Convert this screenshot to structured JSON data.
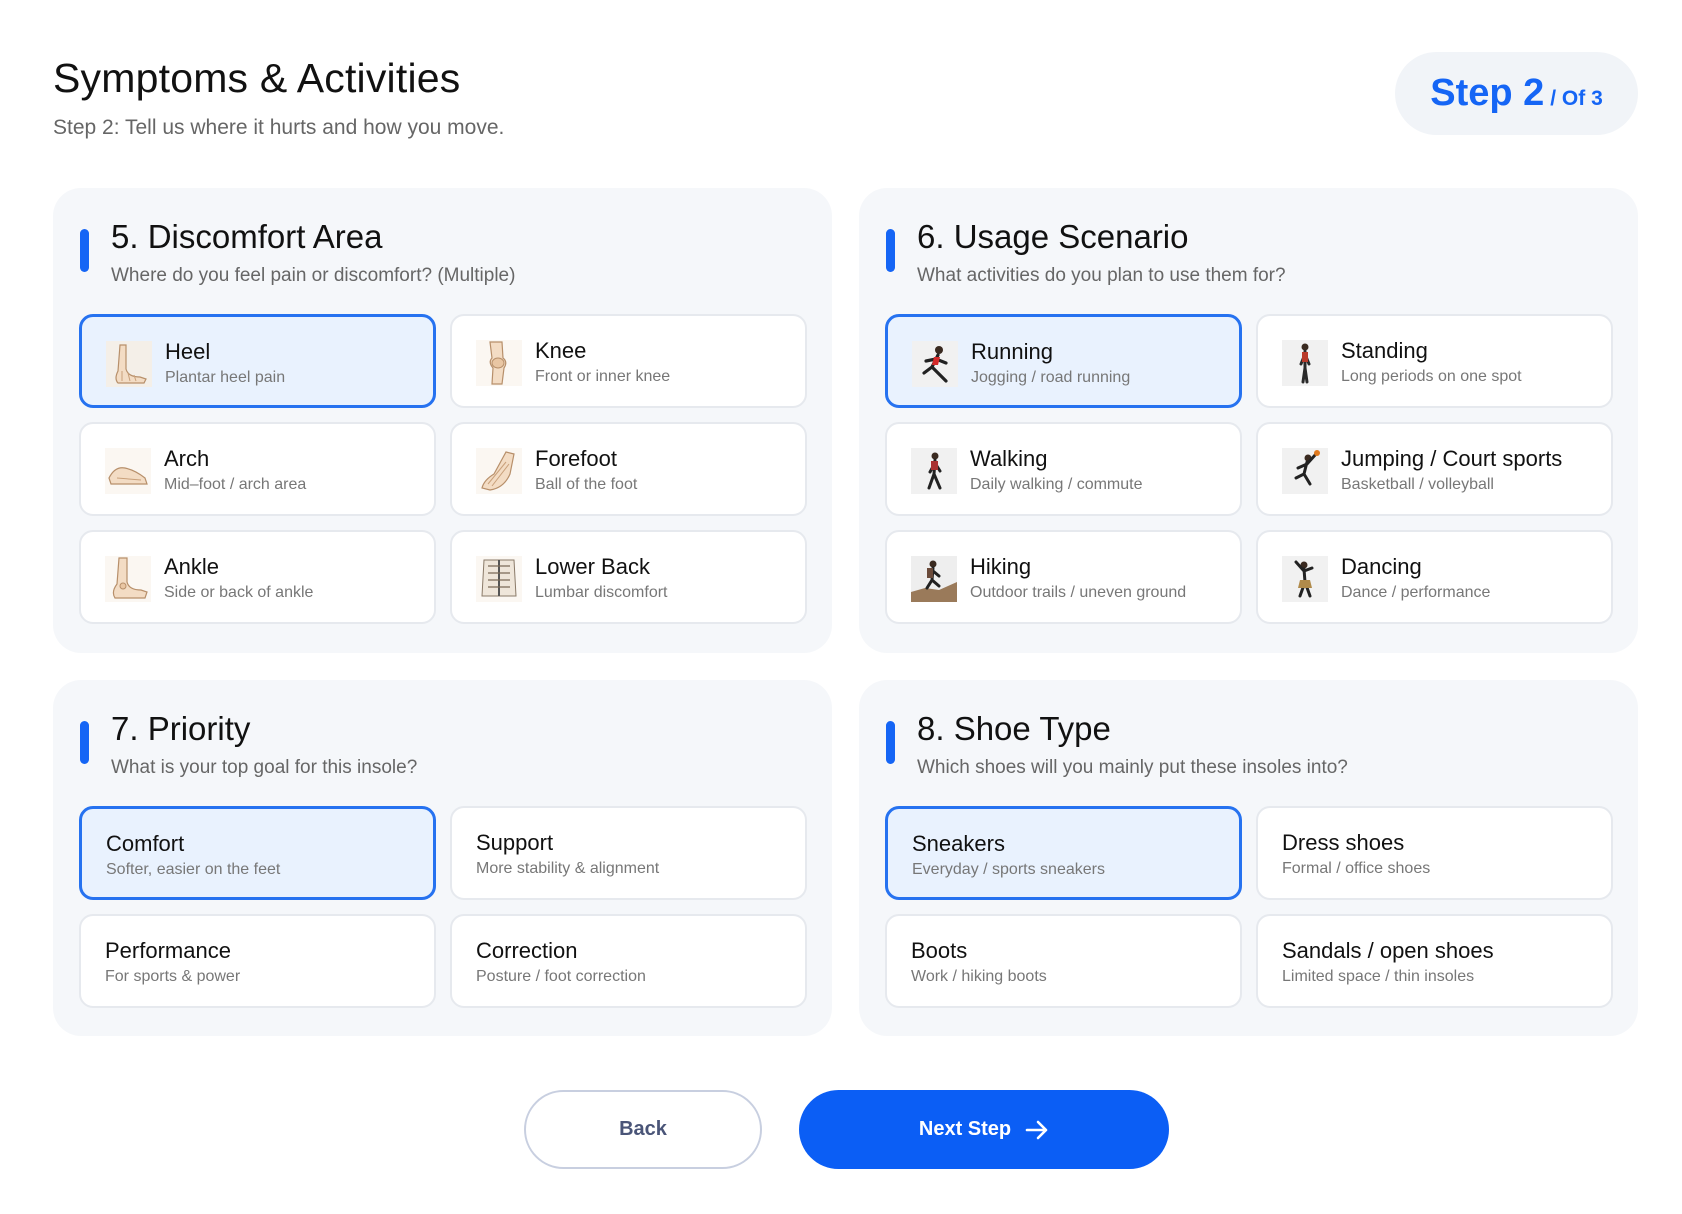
{
  "header": {
    "title": "Symptoms & Activities",
    "subtitle": "Step 2: Tell us where it hurts and how you move."
  },
  "step_indicator": {
    "main": "Step 2",
    "of": "/ Of 3"
  },
  "colors": {
    "accent": "#1565f5",
    "selected_bg": "#e9f2fe",
    "section_bg": "#f5f7fa"
  },
  "sections": [
    {
      "title": "5. Discomfort Area",
      "subtitle": "Where do you feel pain or discomfort? (Multiple)",
      "options": [
        {
          "label": "Heel",
          "desc": "Plantar heel pain",
          "icon": "heel-anatomy-icon",
          "selected": true
        },
        {
          "label": "Knee",
          "desc": "Front or inner knee",
          "icon": "knee-anatomy-icon",
          "selected": false
        },
        {
          "label": "Arch",
          "desc": "Mid–foot / arch area",
          "icon": "arch-anatomy-icon",
          "selected": false
        },
        {
          "label": "Forefoot",
          "desc": "Ball of the foot",
          "icon": "forefoot-anatomy-icon",
          "selected": false
        },
        {
          "label": "Ankle",
          "desc": "Side or back of ankle",
          "icon": "ankle-anatomy-icon",
          "selected": false
        },
        {
          "label": "Lower Back",
          "desc": "Lumbar discomfort",
          "icon": "lower-back-anatomy-icon",
          "selected": false
        }
      ]
    },
    {
      "title": "6. Usage Scenario",
      "subtitle": "What activities do you plan to use them for?",
      "options": [
        {
          "label": "Running",
          "desc": "Jogging / road running",
          "icon": "running-person-icon",
          "selected": true
        },
        {
          "label": "Standing",
          "desc": "Long periods on one spot",
          "icon": "standing-person-icon",
          "selected": false
        },
        {
          "label": "Walking",
          "desc": "Daily walking / commute",
          "icon": "walking-person-icon",
          "selected": false
        },
        {
          "label": "Jumping / Court sports",
          "desc": "Basketball / volleyball",
          "icon": "jumping-person-icon",
          "selected": false
        },
        {
          "label": "Hiking",
          "desc": "Outdoor trails / uneven ground",
          "icon": "hiking-person-icon",
          "selected": false
        },
        {
          "label": "Dancing",
          "desc": "Dance / performance",
          "icon": "dancing-person-icon",
          "selected": false
        }
      ]
    },
    {
      "title": "7. Priority",
      "subtitle": "What is your top goal for this insole?",
      "options": [
        {
          "label": "Comfort",
          "desc": "Softer, easier on the feet",
          "selected": true
        },
        {
          "label": "Support",
          "desc": "More stability & alignment",
          "selected": false
        },
        {
          "label": "Performance",
          "desc": "For sports & power",
          "selected": false
        },
        {
          "label": "Correction",
          "desc": "Posture / foot correction",
          "selected": false
        }
      ]
    },
    {
      "title": "8. Shoe Type",
      "subtitle": "Which shoes will you mainly put these insoles into?",
      "options": [
        {
          "label": "Sneakers",
          "desc": "Everyday / sports sneakers",
          "selected": true
        },
        {
          "label": "Dress shoes",
          "desc": "Formal / office shoes",
          "selected": false
        },
        {
          "label": "Boots",
          "desc": "Work / hiking boots",
          "selected": false
        },
        {
          "label": "Sandals / open shoes",
          "desc": "Limited space / thin insoles",
          "selected": false
        }
      ]
    }
  ],
  "buttons": {
    "back": "Back",
    "next": "Next Step"
  }
}
